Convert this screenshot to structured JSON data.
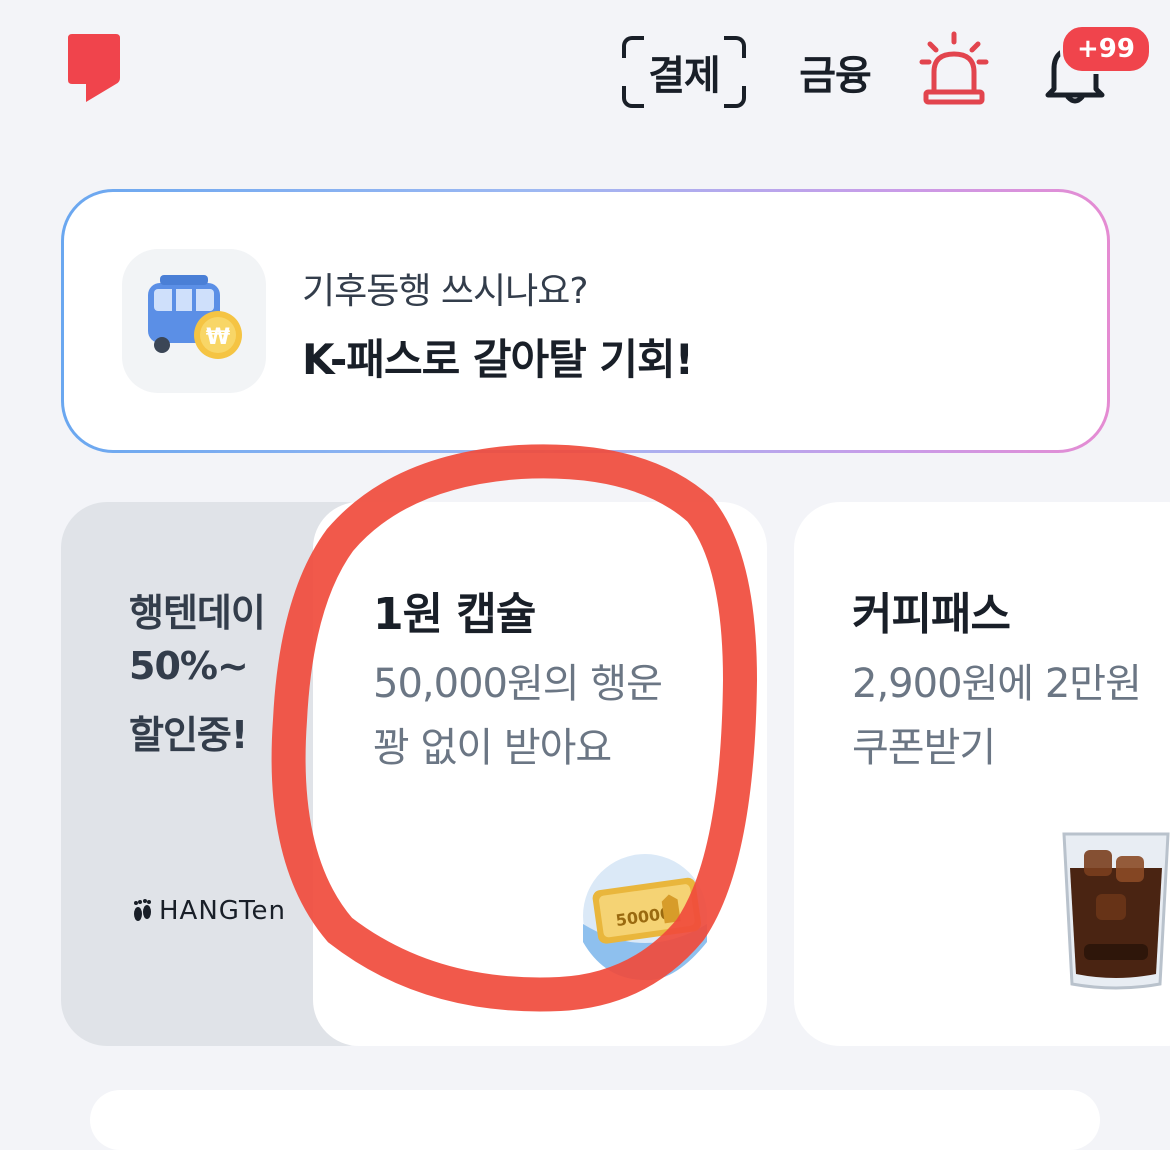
{
  "header": {
    "pay_label": "결제",
    "finance_label": "금융",
    "notification_count": "+99",
    "accent_color": "#f0444c"
  },
  "promo": {
    "question": "기후동행 쓰시나요?",
    "title": "K-패스로 갈아탈 기회!",
    "icon": "bus-coin-icon"
  },
  "cards": [
    {
      "lines": [
        "행텐데이",
        "50%~",
        "할인중!"
      ],
      "brand": "HANGTen"
    },
    {
      "title": "1원 캡슐",
      "subtitle_lines": [
        "50,000원의 행운",
        "꽝 없이 받아요"
      ],
      "image_text": "50000"
    },
    {
      "title": "커피패스",
      "subtitle_lines": [
        "2,900원에 2만원",
        "쿠폰받기"
      ]
    }
  ],
  "annotation": {
    "color": "#f04b3c",
    "shape": "circle"
  }
}
